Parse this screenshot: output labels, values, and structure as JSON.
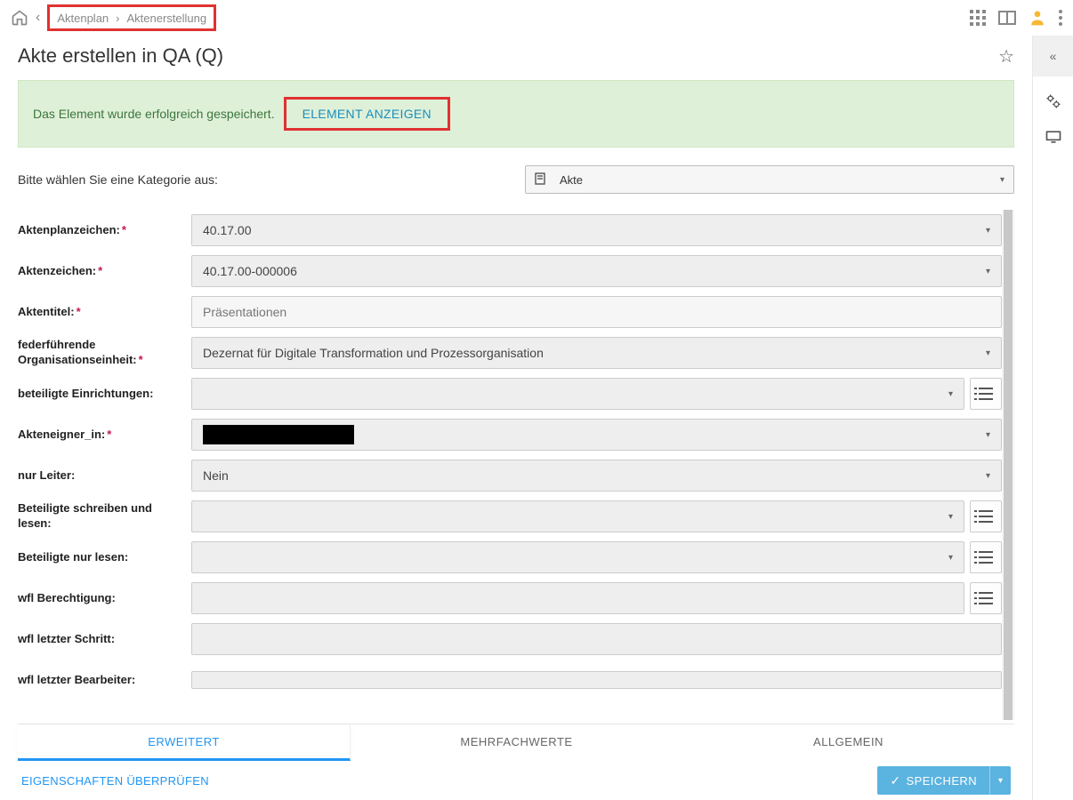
{
  "breadcrumb": {
    "item1": "Aktenplan",
    "item2": "Aktenerstellung"
  },
  "page": {
    "title": "Akte erstellen in QA (Q)"
  },
  "alert": {
    "message": "Das Element wurde erfolgreich gespeichert.",
    "link_label": "ELEMENT ANZEIGEN"
  },
  "category": {
    "label": "Bitte wählen Sie eine Kategorie aus:",
    "value": "Akte"
  },
  "form": {
    "aktenplanzeichen": {
      "label": "Aktenplanzeichen:",
      "value": "40.17.00",
      "required": true
    },
    "aktenzeichen": {
      "label": "Aktenzeichen:",
      "value": "40.17.00-000006",
      "required": true
    },
    "aktentitel": {
      "label": "Aktentitel:",
      "value": "Präsentationen",
      "required": true
    },
    "federfuehrende": {
      "label": "federführende Organisationseinheit:",
      "value": "Dezernat für Digitale Transformation und Prozessorganisation",
      "required": true
    },
    "beteiligte_einr": {
      "label": "beteiligte Einrichtungen:",
      "value": ""
    },
    "akteneigner": {
      "label": "Akteneigner_in:",
      "value": "",
      "required": true,
      "redacted": true
    },
    "nur_leiter": {
      "label": "nur Leiter:",
      "value": "Nein"
    },
    "bet_schreiben": {
      "label": "Beteiligte schreiben und lesen:",
      "value": ""
    },
    "bet_lesen": {
      "label": "Beteiligte nur lesen:",
      "value": ""
    },
    "wfl_berechtigung": {
      "label": "wfl Berechtigung:",
      "value": ""
    },
    "wfl_letzter_schritt": {
      "label": "wfl letzter Schritt:",
      "value": ""
    },
    "wfl_letzter_bearb": {
      "label": "wfl letzter Bearbeiter:",
      "value": ""
    }
  },
  "tabs": {
    "t1": "ERWEITERT",
    "t2": "MEHRFACHWERTE",
    "t3": "ALLGEMEIN"
  },
  "footer": {
    "check": "EIGENSCHAFTEN ÜBERPRÜFEN",
    "save": "SPEICHERN"
  }
}
